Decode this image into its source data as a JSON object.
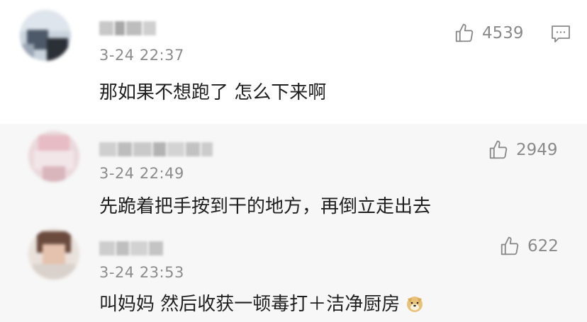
{
  "comments": [
    {
      "time": "3-24 22:37",
      "text": "那如果不想跑了 怎么下来啊",
      "likes": "4539",
      "like_icon": "thumbs-up-icon",
      "reply_icon": "comment-icon"
    },
    {
      "time": "3-24 22:49",
      "text": "先跪着把手按到干的地方，再倒立走出去",
      "likes": "2949",
      "like_icon": "thumbs-up-icon"
    },
    {
      "time": "3-24 23:53",
      "text": "叫妈妈  然后收获一顿毒打＋洁净厨房",
      "likes": "622",
      "like_icon": "thumbs-up-icon",
      "emoji": "doge-emoji-icon"
    }
  ],
  "colors": {
    "meta_text": "#8c8c8c",
    "body_text": "#1f1f1f",
    "reply_bg": "#f7f7f7"
  }
}
